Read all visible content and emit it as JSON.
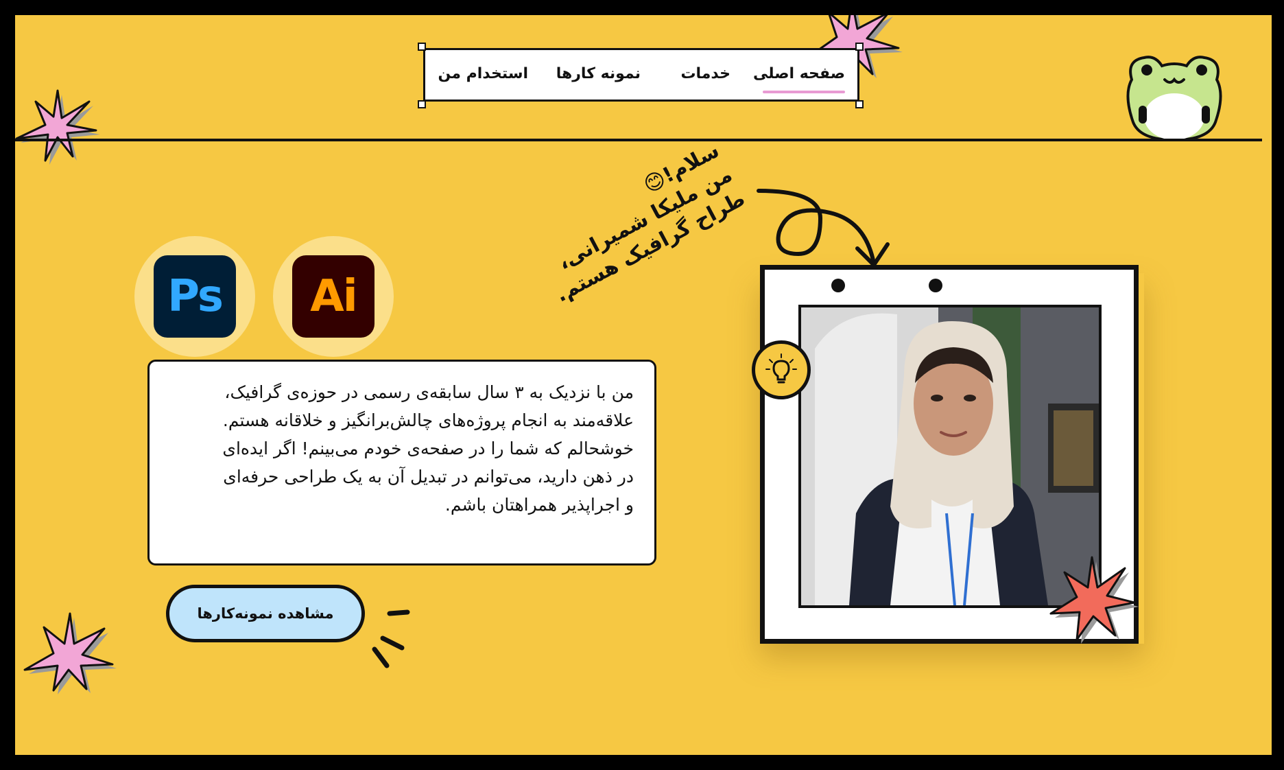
{
  "nav": {
    "items": [
      {
        "label": "صفحه اصلی",
        "active": true
      },
      {
        "label": "خدمات",
        "active": false
      },
      {
        "label": "نمونه کارها",
        "active": false
      },
      {
        "label": "استخدام من",
        "active": false
      }
    ]
  },
  "greeting": {
    "line1": "سلام!😊",
    "line2": "من ملیکا شمیرانی،",
    "line3": "طراح گرافیک هستم."
  },
  "apps": {
    "photoshop": {
      "label": "Ps",
      "bg": "#001e36",
      "fg": "#31a8ff"
    },
    "illustrator": {
      "label": "Ai",
      "bg": "#330000",
      "fg": "#ff9a00"
    }
  },
  "about": {
    "lines": [
      "من با نزدیک به ۳ سال سابقه‌ی رسمی در حوزه‌ی گرافیک،",
      "علاقه‌مند به انجام پروژه‌های چالش‌برانگیز و خلاقانه هستم.",
      "خوشحالم که شما را در صفحه‌ی خودم می‌بینم! اگر ایده‌ای",
      "در ذهن دارید، می‌توانم در تبدیل آن به یک طراحی حرفه‌ای",
      "و اجراپذیر همراهتان باشم."
    ]
  },
  "cta": {
    "label": "مشاهده نمونه‌کارها"
  },
  "colors": {
    "background": "#f6c843",
    "accent_pink": "#f2a6d6",
    "accent_red": "#f26b5b",
    "button": "#bfe4fb",
    "frog": "#c6e58e"
  },
  "icons": {
    "decor": [
      "sparkle-star-icon",
      "frog-mascot-icon",
      "curly-arrow-icon",
      "lightbulb-icon",
      "sparkle-lines-icon"
    ]
  }
}
